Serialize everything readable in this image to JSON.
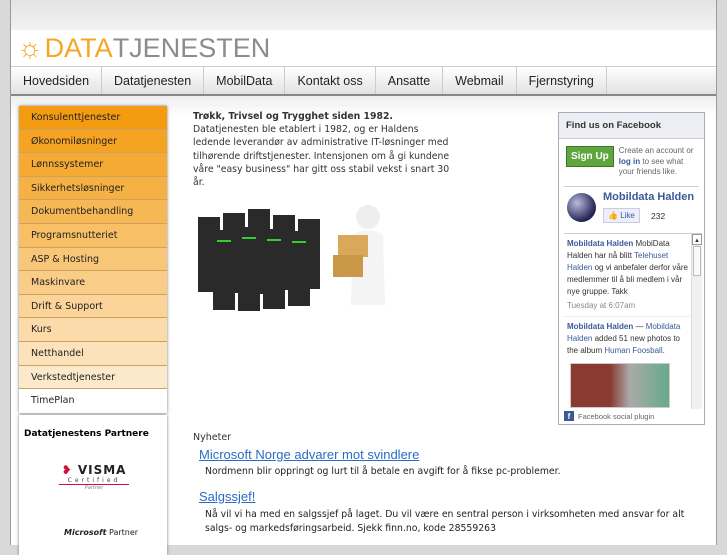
{
  "logo": {
    "part1": "DATA",
    "part2": "TJENESTEN"
  },
  "nav": [
    "Hovedsiden",
    "Datatjenesten",
    "MobilData",
    "Kontakt oss",
    "Ansatte",
    "Webmail",
    "Fjernstyring"
  ],
  "menu": [
    "Konsulenttjenester",
    "Økonomiløsninger",
    "Lønnssystemer",
    "Sikkerhetsløsninger",
    "Dokumentbehandling",
    "Programsnutteriet",
    "ASP & Hosting",
    "Maskinvare",
    "Drift & Support",
    "Kurs",
    "Netthandel",
    "Verkstedtjenester",
    "TimePlan"
  ],
  "partners": {
    "title": "Datatjenestens Partnere",
    "visma": "VISMA",
    "certified": "Certified",
    "partner": "Partner",
    "microsoft": "Microsoft",
    "ms_partner": "Partner"
  },
  "intro": {
    "bold": "Trøkk, Trivsel og Trygghet siden 1982.",
    "text": " Datatjenesten ble etablert i 1982, og er Haldens ledende leverandør av administrative IT-løsninger med tilhørende driftstjenester. Intensjonen om å gi kundene våre \"easy business\" har gitt oss stabil vekst i snart 30 år."
  },
  "news": {
    "heading": "Nyheter",
    "items": [
      {
        "title": "Microsoft Norge advarer mot svindlere",
        "body": "Nordmenn blir oppringt og lurt til å betale en avgift for å fikse pc-problemer."
      },
      {
        "title": "Salgssjef!",
        "body": "Nå vil vi ha med en salgssjef på laget. Du vil være en sentral person i virksomheten med ansvar for alt salgs- og markedsføringsarbeid. Sjekk finn.no, kode 28559263"
      }
    ]
  },
  "facebook": {
    "header": "Find us on Facebook",
    "signup": "Sign Up",
    "create1": "Create an account or",
    "login": "log in",
    "create2": "to see what your friends like.",
    "page": "Mobildata Halden",
    "like": "Like",
    "likes": "232",
    "post1": {
      "author": "Mobildata Halden",
      "t1": " MobiData Halden har nå blitt ",
      "link": "Telehuset Halden",
      "t2": " og vi anbefaler derfor våre medlemmer til å bli medlem i vår nye gruppe. Takk",
      "time": "Tuesday at 6:07am"
    },
    "post2": {
      "author": "Mobildata Halden",
      "dash": " — ",
      "link": "Mobildata Halden",
      "t1": " added 51 new photos to the album ",
      "album": "Human Foosball",
      "dot": "."
    },
    "footer": "Facebook social plugin"
  }
}
